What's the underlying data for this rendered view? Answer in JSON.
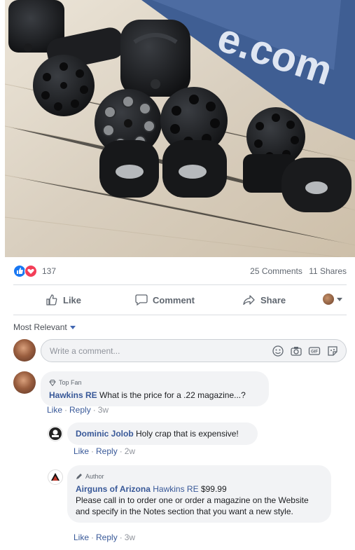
{
  "post": {
    "image_alt": "Black rotary airgun magazines on a wooden surface",
    "watermark_text": "e.com"
  },
  "stats": {
    "reaction_count": "137",
    "comments": "25 Comments",
    "shares": "11 Shares"
  },
  "actions": {
    "like": "Like",
    "comment": "Comment",
    "share": "Share"
  },
  "sort": {
    "label": "Most Relevant"
  },
  "composer": {
    "placeholder": "Write a comment..."
  },
  "comments": [
    {
      "badge": "Top Fan",
      "author": "Hawkins RE",
      "text": "What is the price for a .22 magazine...?",
      "like": "Like",
      "reply": "Reply",
      "time": "3w"
    },
    {
      "author": "Dominic Jolob",
      "text": "Holy crap that is expensive!",
      "like": "Like",
      "reply": "Reply",
      "time": "2w"
    },
    {
      "badge": "Author",
      "author": "Airguns of Arizona",
      "mention": "Hawkins RE",
      "text_first": "$99.99",
      "text": "Please call in to order one or order a magazine on the Website and specify in the Notes section that you want a new style.",
      "like": "Like",
      "reply": "Reply",
      "time": "3w"
    }
  ],
  "colors": {
    "link": "#385898",
    "like_blue": "#1877f2",
    "love_red": "#f33e58",
    "bubble_bg": "#f2f3f5"
  }
}
